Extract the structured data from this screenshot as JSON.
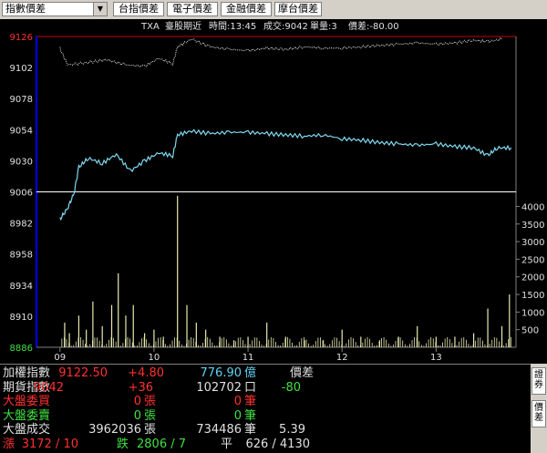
{
  "toolbar": {
    "index_select": "指數價差",
    "buttons": [
      "台指價差",
      "電子價差",
      "金融價差",
      "摩台價差"
    ]
  },
  "chart_header": {
    "symbol": "TXA",
    "product": "臺股期近",
    "time": "時間:13:45",
    "volume": "成交:9042",
    "unit": "單量:3",
    "spread": "價差:-80.00"
  },
  "chart_data": {
    "type": "line",
    "x_ticks": [
      "09",
      "10",
      "11",
      "12",
      "13"
    ],
    "price_axis_ticks": [
      "9126",
      "9102",
      "9078",
      "9054",
      "9030",
      "9006",
      "8982",
      "8958",
      "8934",
      "8910",
      "8886"
    ],
    "volume_axis_ticks": [
      "4000",
      "3500",
      "3000",
      "2500",
      "2000",
      "1500",
      "1000",
      "500"
    ],
    "price_ylim": [
      8886,
      9126
    ],
    "volume_ylim": [
      0,
      4400
    ],
    "reference_price": 9006,
    "colors": {
      "futures": "#7fd9f0",
      "index": "#e0e0e0",
      "volume": "#e8e8b0",
      "reference": "#ffffff",
      "axis": "#0000ff",
      "limit": "#c00000"
    },
    "futures_series": [
      [
        9.0,
        8985
      ],
      [
        9.08,
        8993
      ],
      [
        9.15,
        9005
      ],
      [
        9.2,
        9025
      ],
      [
        9.3,
        9032
      ],
      [
        9.45,
        9028
      ],
      [
        9.6,
        9035
      ],
      [
        9.75,
        9022
      ],
      [
        9.9,
        9030
      ],
      [
        10.05,
        9036
      ],
      [
        10.2,
        9034
      ],
      [
        10.25,
        9050
      ],
      [
        10.4,
        9053
      ],
      [
        10.6,
        9051
      ],
      [
        10.8,
        9052
      ],
      [
        11.0,
        9052
      ],
      [
        11.2,
        9051
      ],
      [
        11.4,
        9050
      ],
      [
        11.6,
        9049
      ],
      [
        11.8,
        9050
      ],
      [
        12.0,
        9047
      ],
      [
        12.2,
        9046
      ],
      [
        12.4,
        9044
      ],
      [
        12.6,
        9043
      ],
      [
        12.8,
        9042
      ],
      [
        13.0,
        9043
      ],
      [
        13.2,
        9041
      ],
      [
        13.4,
        9040
      ],
      [
        13.55,
        9034
      ],
      [
        13.65,
        9040
      ],
      [
        13.8,
        9040
      ]
    ],
    "index_series": [
      [
        9.0,
        9117
      ],
      [
        9.08,
        9104
      ],
      [
        9.3,
        9106
      ],
      [
        9.5,
        9108
      ],
      [
        9.7,
        9104
      ],
      [
        9.9,
        9103
      ],
      [
        10.05,
        9109
      ],
      [
        10.2,
        9105
      ],
      [
        10.25,
        9118
      ],
      [
        10.4,
        9124
      ],
      [
        10.6,
        9118
      ],
      [
        10.8,
        9116
      ],
      [
        11.0,
        9115
      ],
      [
        11.2,
        9117
      ],
      [
        11.4,
        9116
      ],
      [
        11.6,
        9118
      ],
      [
        11.8,
        9117
      ],
      [
        12.0,
        9117
      ],
      [
        12.2,
        9118
      ],
      [
        12.4,
        9119
      ],
      [
        12.6,
        9120
      ],
      [
        12.8,
        9121
      ],
      [
        13.0,
        9120
      ],
      [
        13.2,
        9121
      ],
      [
        13.4,
        9123
      ],
      [
        13.55,
        9122
      ],
      [
        13.7,
        9124
      ]
    ],
    "volume_bars": [
      [
        9.05,
        700
      ],
      [
        9.1,
        400
      ],
      [
        9.2,
        900
      ],
      [
        9.28,
        500
      ],
      [
        9.35,
        1300
      ],
      [
        9.45,
        600
      ],
      [
        9.55,
        1200
      ],
      [
        9.62,
        2100
      ],
      [
        9.7,
        900
      ],
      [
        9.78,
        1200
      ],
      [
        9.9,
        400
      ],
      [
        10.0,
        500
      ],
      [
        10.1,
        300
      ],
      [
        10.25,
        4300
      ],
      [
        10.35,
        1200
      ],
      [
        10.45,
        700
      ],
      [
        10.55,
        500
      ],
      [
        10.7,
        300
      ],
      [
        10.85,
        200
      ],
      [
        11.0,
        300
      ],
      [
        11.2,
        700
      ],
      [
        11.4,
        300
      ],
      [
        11.6,
        200
      ],
      [
        11.8,
        200
      ],
      [
        12.0,
        500
      ],
      [
        12.2,
        300
      ],
      [
        12.4,
        200
      ],
      [
        12.6,
        300
      ],
      [
        12.8,
        600
      ],
      [
        13.0,
        300
      ],
      [
        13.2,
        300
      ],
      [
        13.4,
        400
      ],
      [
        13.55,
        1100
      ],
      [
        13.7,
        600
      ],
      [
        13.78,
        1500
      ]
    ]
  },
  "quotes": {
    "row1": {
      "label": "加權指數",
      "value": "9122.50",
      "change": "+4.80",
      "amount": "776.90",
      "amount_unit": "億",
      "right_label": "價差"
    },
    "row2": {
      "label": "期貨指數",
      "value": "9042",
      "change": "+36",
      "amount": "102702",
      "amount_unit": "口",
      "right_value": "-80"
    },
    "row3": {
      "label": "大盤委買",
      "value": "0",
      "unit": "張",
      "amount": "0",
      "amount_unit": "筆"
    },
    "row4": {
      "label": "大盤委賣",
      "value": "0",
      "unit": "張",
      "amount": "0",
      "amount_unit": "筆"
    },
    "row5": {
      "label": "大盤成交",
      "value": "3962036",
      "unit": "張",
      "amount": "734486",
      "amount_unit": "筆",
      "right_value": "5.39"
    },
    "row6": {
      "up_label": "漲",
      "up_value": "3172 / 10",
      "down_label": "跌",
      "down_value": "2806 / 7",
      "flat_label": "平",
      "flat_value": "626 / 4130"
    }
  },
  "sidebar": {
    "btn1": [
      "證",
      "券"
    ],
    "btn2": [
      "價",
      "差"
    ]
  }
}
